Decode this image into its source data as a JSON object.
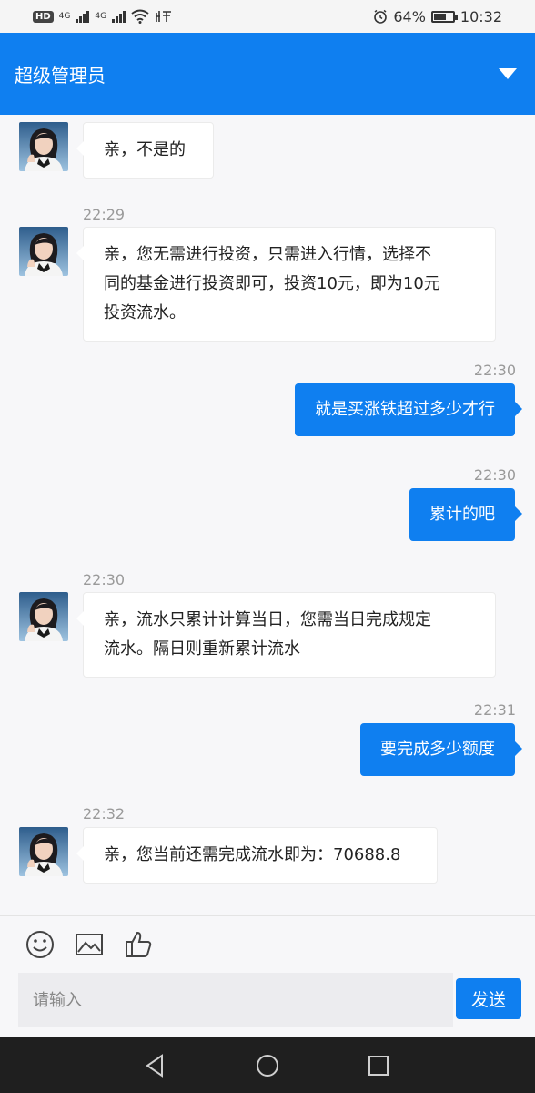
{
  "status_bar": {
    "hd": "HD",
    "network_1": "4G",
    "network_2": "4G",
    "battery_percent": "64%",
    "battery_level": 0.64,
    "time": "10:32",
    "icons": [
      "hd-icon",
      "signal-icon",
      "signal-icon",
      "wifi-icon",
      "listen-icon",
      "alarm-icon",
      "battery-icon"
    ]
  },
  "header": {
    "title": "超级管理员",
    "dropdown_icon": "chevron-down-icon"
  },
  "messages": [
    {
      "side": "left",
      "time": "",
      "text": "亲，不是的"
    },
    {
      "side": "left",
      "time": "22:29",
      "text": "亲，您无需进行投资，只需进入行情，选择不\n同的基金进行投资即可，投资10元，即为10元\n投资流水。"
    },
    {
      "side": "right",
      "time": "22:30",
      "text": "就是买涨铁超过多少才行"
    },
    {
      "side": "right",
      "time": "22:30",
      "text": "累计的吧"
    },
    {
      "side": "left",
      "time": "22:30",
      "text": "亲，流水只累计计算当日，您需当日完成规定\n流水。隔日则重新累计流水"
    },
    {
      "side": "right",
      "time": "22:31",
      "text": "要完成多少额度"
    },
    {
      "side": "left",
      "time": "22:32",
      "text": "亲，您当前还需完成流水即为：70688.8"
    }
  ],
  "composer": {
    "placeholder": "请输入",
    "send_label": "发送",
    "tools": [
      "emoji-icon",
      "image-icon",
      "thumbs-up-icon"
    ]
  },
  "nav": {
    "icons": [
      "back-icon",
      "home-icon",
      "recents-icon"
    ]
  },
  "colors": {
    "accent": "#0f7ff0",
    "background": "#f7f7f9"
  }
}
